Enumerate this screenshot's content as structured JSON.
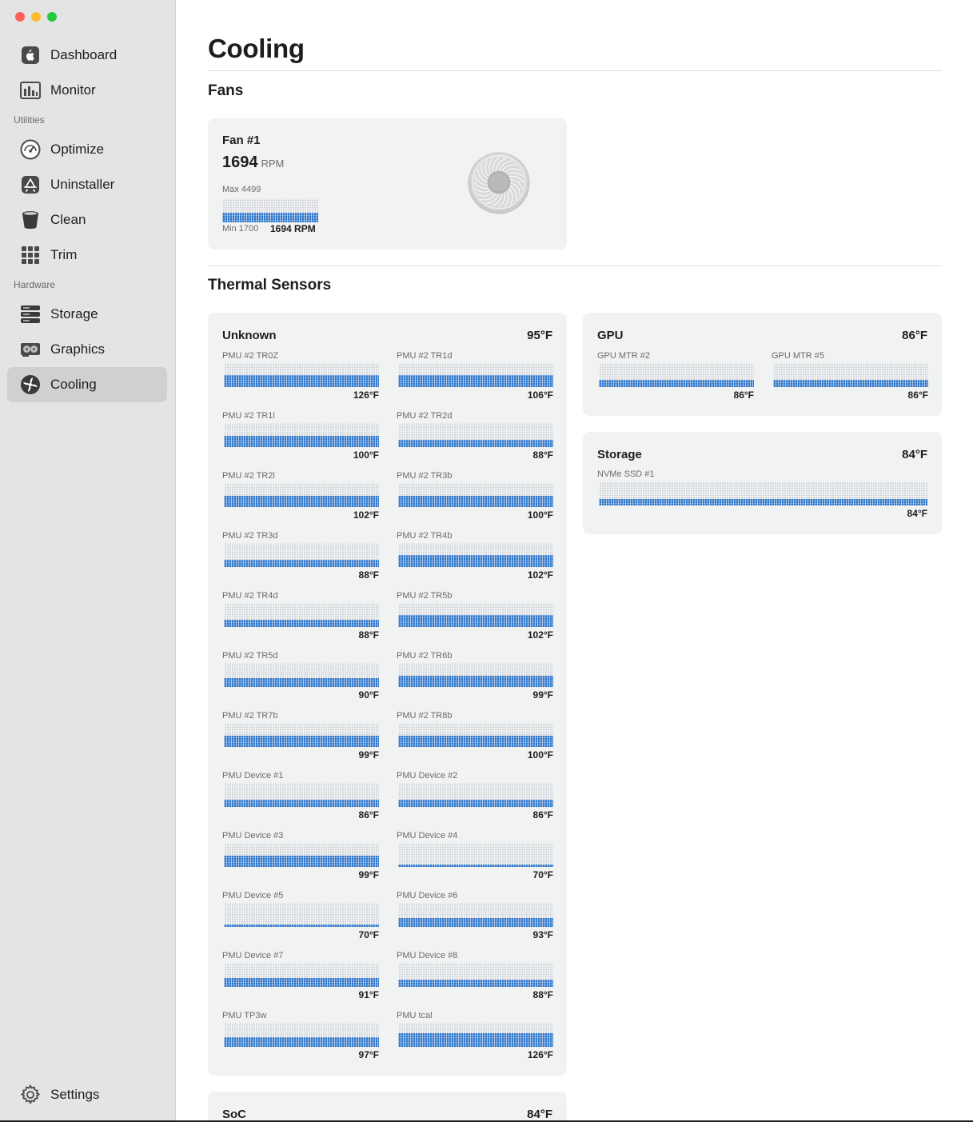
{
  "sidebar": {
    "items_top": [
      {
        "label": "Dashboard",
        "icon": "apple-logo-icon"
      },
      {
        "label": "Monitor",
        "icon": "bar-chart-icon"
      }
    ],
    "utilities_label": "Utilities",
    "items_utilities": [
      {
        "label": "Optimize",
        "icon": "gauge-icon"
      },
      {
        "label": "Uninstaller",
        "icon": "app-store-icon"
      },
      {
        "label": "Clean",
        "icon": "trash-bin-icon"
      },
      {
        "label": "Trim",
        "icon": "grid-icon"
      }
    ],
    "hardware_label": "Hardware",
    "items_hardware": [
      {
        "label": "Storage",
        "icon": "server-drive-icon"
      },
      {
        "label": "Graphics",
        "icon": "graphics-card-icon"
      },
      {
        "label": "Cooling",
        "icon": "fan-icon",
        "active": true
      }
    ],
    "settings_label": "Settings"
  },
  "page": {
    "title": "Cooling",
    "fans_heading": "Fans",
    "thermal_heading": "Thermal Sensors"
  },
  "fan": {
    "name": "Fan #1",
    "rpm": "1694",
    "rpm_unit": "RPM",
    "max": "Max 4499",
    "min": "Min 1700",
    "current": "1694 RPM",
    "level": 0.4
  },
  "groups": {
    "unknown": {
      "title": "Unknown",
      "temp": "95°F",
      "sensors": [
        {
          "label": "PMU #2 TR0Z",
          "value": "126°F",
          "level": 0.5
        },
        {
          "label": "PMU #2 TR1d",
          "value": "106°F",
          "level": 0.5
        },
        {
          "label": "PMU #2 TR1l",
          "value": "100°F",
          "level": 0.45
        },
        {
          "label": "PMU #2 TR2d",
          "value": "88°F",
          "level": 0.3
        },
        {
          "label": "PMU #2 TR2l",
          "value": "102°F",
          "level": 0.45
        },
        {
          "label": "PMU #2 TR3b",
          "value": "100°F",
          "level": 0.45
        },
        {
          "label": "PMU #2 TR3d",
          "value": "88°F",
          "level": 0.3
        },
        {
          "label": "PMU #2 TR4b",
          "value": "102°F",
          "level": 0.5
        },
        {
          "label": "PMU #2 TR4d",
          "value": "88°F",
          "level": 0.3
        },
        {
          "label": "PMU #2 TR5b",
          "value": "102°F",
          "level": 0.5
        },
        {
          "label": "PMU #2 TR5d",
          "value": "90°F",
          "level": 0.35
        },
        {
          "label": "PMU #2 TR6b",
          "value": "99°F",
          "level": 0.45
        },
        {
          "label": "PMU #2 TR7b",
          "value": "99°F",
          "level": 0.45
        },
        {
          "label": "PMU #2 TR8b",
          "value": "100°F",
          "level": 0.45
        },
        {
          "label": "PMU Device #1",
          "value": "86°F",
          "level": 0.3
        },
        {
          "label": "PMU Device #2",
          "value": "86°F",
          "level": 0.3
        },
        {
          "label": "PMU Device #3",
          "value": "99°F",
          "level": 0.45
        },
        {
          "label": "PMU Device #4",
          "value": "70°F",
          "level": 0.1
        },
        {
          "label": "PMU Device #5",
          "value": "70°F",
          "level": 0.1
        },
        {
          "label": "PMU Device #6",
          "value": "93°F",
          "level": 0.35
        },
        {
          "label": "PMU Device #7",
          "value": "91°F",
          "level": 0.35
        },
        {
          "label": "PMU Device #8",
          "value": "88°F",
          "level": 0.3
        },
        {
          "label": "PMU TP3w",
          "value": "97°F",
          "level": 0.4
        },
        {
          "label": "PMU tcal",
          "value": "126°F",
          "level": 0.55
        }
      ]
    },
    "gpu": {
      "title": "GPU",
      "temp": "86°F",
      "sensors": [
        {
          "label": "GPU MTR #2",
          "value": "86°F",
          "level": 0.3
        },
        {
          "label": "GPU MTR #5",
          "value": "86°F",
          "level": 0.3
        }
      ]
    },
    "storage": {
      "title": "Storage",
      "temp": "84°F",
      "sensors": [
        {
          "label": "NVMe SSD #1",
          "value": "84°F",
          "level": 0.28
        }
      ]
    },
    "soc": {
      "title": "SoC",
      "temp": "84°F"
    }
  },
  "colors": {
    "sidebar_bg": "#e4e4e4",
    "active_item_bg": "#d0d0d0",
    "bar_fill": "#2f74c6",
    "card_bg": "#f1f2f2"
  }
}
